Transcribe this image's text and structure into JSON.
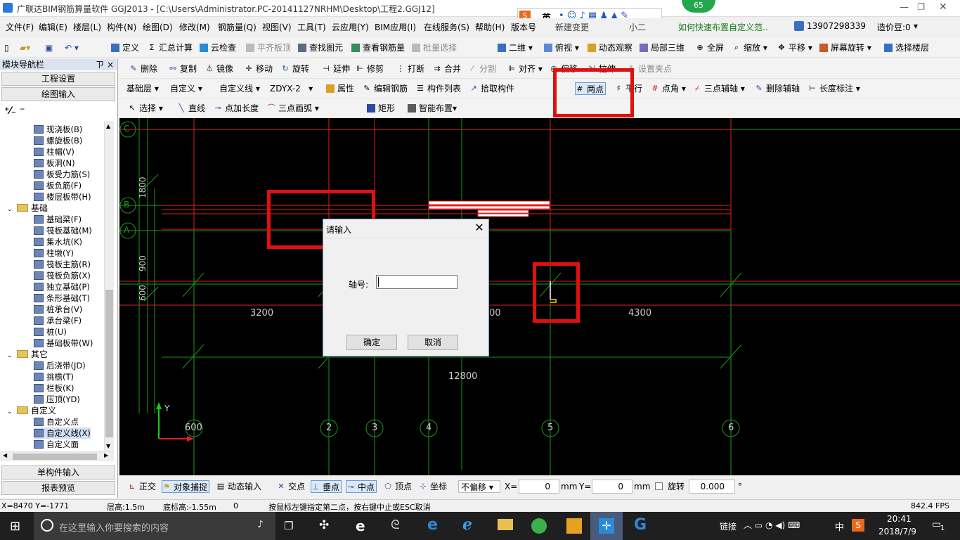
{
  "window": {
    "title": "广联达BIM钢筋算量软件 GGJ2013 - [C:\\Users\\Administrator.PC-20141127NRHM\\Desktop\\工程2.GGJ12]",
    "badge": "65",
    "ime_label": "英",
    "hint_link": "如何快速布置自定义范..",
    "phone": "13907298339",
    "coins": "造价豆:0"
  },
  "menu": [
    "文件(F)",
    "编辑(E)",
    "楼层(L)",
    "构件(N)",
    "绘图(D)",
    "修改(M)",
    "钢筋量(Q)",
    "视图(V)",
    "工具(T)",
    "云应用(Y)",
    "BIM应用(I)",
    "在线服务(S)",
    "帮助(H)",
    "版本号",
    "新建变更",
    "小二"
  ],
  "toolbar1": [
    "定义",
    "汇总计算",
    "云检查",
    "平齐板顶",
    "查找图元",
    "查看钢筋量",
    "批量选择",
    "二维",
    "俯视",
    "动态观察",
    "局部三维",
    "全屏",
    "缩放",
    "平移",
    "屏幕旋转",
    "选择楼层"
  ],
  "toolbar2": [
    "删除",
    "复制",
    "镜像",
    "移动",
    "旋转",
    "延伸",
    "修剪",
    "打断",
    "合并",
    "分割",
    "对齐",
    "偏移",
    "拉伸",
    "设置夹点"
  ],
  "toolbar3": {
    "floor": "基础层",
    "category": "自定义",
    "type": "自定义线",
    "item": "ZDYX-2",
    "buttons": [
      "属性",
      "编辑钢筋",
      "构件列表",
      "拾取构件"
    ],
    "axis_buttons": [
      "两点",
      "平行",
      "点角",
      "三点辅轴",
      "删除辅轴",
      "长度标注"
    ]
  },
  "toolbar4": [
    "选择",
    "直线",
    "点加长度",
    "三点画弧",
    "矩形",
    "智能布置"
  ],
  "leftpanel": {
    "title": "模块导航栏",
    "pin": "ㄗ",
    "close": "×",
    "tab_top1": "工程设置",
    "tab_top2": "绘图输入",
    "tab_bottom1": "单构件输入",
    "tab_bottom2": "报表预览",
    "tree": [
      {
        "kind": "item",
        "label": "现浇板(B)"
      },
      {
        "kind": "item",
        "label": "螺旋板(B)"
      },
      {
        "kind": "item",
        "label": "柱帽(V)"
      },
      {
        "kind": "item",
        "label": "板洞(N)"
      },
      {
        "kind": "item",
        "label": "板受力筋(S)"
      },
      {
        "kind": "item",
        "label": "板负筋(F)"
      },
      {
        "kind": "item",
        "label": "楼层板带(H)"
      },
      {
        "kind": "folder",
        "label": "基础"
      },
      {
        "kind": "item",
        "label": "基础梁(F)"
      },
      {
        "kind": "item",
        "label": "筏板基础(M)"
      },
      {
        "kind": "item",
        "label": "集水坑(K)"
      },
      {
        "kind": "item",
        "label": "柱墩(Y)"
      },
      {
        "kind": "item",
        "label": "筏板主筋(R)"
      },
      {
        "kind": "item",
        "label": "筏板负筋(X)"
      },
      {
        "kind": "item",
        "label": "独立基础(P)"
      },
      {
        "kind": "item",
        "label": "条形基础(T)"
      },
      {
        "kind": "item",
        "label": "桩承台(V)"
      },
      {
        "kind": "item",
        "label": "承台梁(F)"
      },
      {
        "kind": "item",
        "label": "桩(U)"
      },
      {
        "kind": "item",
        "label": "基础板带(W)"
      },
      {
        "kind": "folder",
        "label": "其它"
      },
      {
        "kind": "item",
        "label": "后浇带(JD)"
      },
      {
        "kind": "item",
        "label": "挑檐(T)"
      },
      {
        "kind": "item",
        "label": "栏板(K)"
      },
      {
        "kind": "item",
        "label": "压顶(YD)"
      },
      {
        "kind": "folder",
        "label": "自定义"
      },
      {
        "kind": "item",
        "label": "自定义点"
      },
      {
        "kind": "item",
        "label": "自定义线(X)"
      },
      {
        "kind": "item",
        "label": "自定义面"
      }
    ]
  },
  "canvas": {
    "axis_rows": [
      "C",
      "B",
      "A"
    ],
    "axis_cols": [
      "2",
      "3",
      "4",
      "5",
      "6"
    ],
    "col_first": "600",
    "dims": [
      "3200",
      "00",
      "4300",
      "12800"
    ],
    "side_dims": [
      "1800",
      "900",
      "600"
    ],
    "y_axis": "Y",
    "x_axis": "X"
  },
  "dialog": {
    "title": "请输入",
    "label": "轴号:",
    "value": "",
    "ok": "确定",
    "cancel": "取消"
  },
  "snapbar": {
    "buttons": [
      "正交",
      "对象捕捉",
      "动态输入",
      "交点",
      "垂点",
      "中点",
      "顶点",
      "坐标"
    ],
    "offset": "不偏移",
    "x_label": "X=",
    "x_value": "0",
    "y_label": "Y=",
    "y_value": "0",
    "unit": "mm",
    "rotate_label": "旋转",
    "rotate_value": "0.000",
    "deg": "°"
  },
  "status": {
    "coords": "X=8470 Y=-1771",
    "floor_height": "层高:1.5m",
    "base_height": "底标高:-1.55m",
    "zero": "0",
    "prompt": "按鼠标左键指定第二点，按右键中止或ESC取消",
    "fps": "842.4 FPS"
  },
  "taskbar": {
    "search_placeholder": "在这里输入你要搜索的内容",
    "link": "链接",
    "lang": "中",
    "time": "20:41",
    "date": "2018/7/9",
    "notify": "1"
  },
  "colors": {
    "grid_red": "#e02020",
    "grid_green": "#1a9a1a",
    "highlight": "#e01010"
  }
}
